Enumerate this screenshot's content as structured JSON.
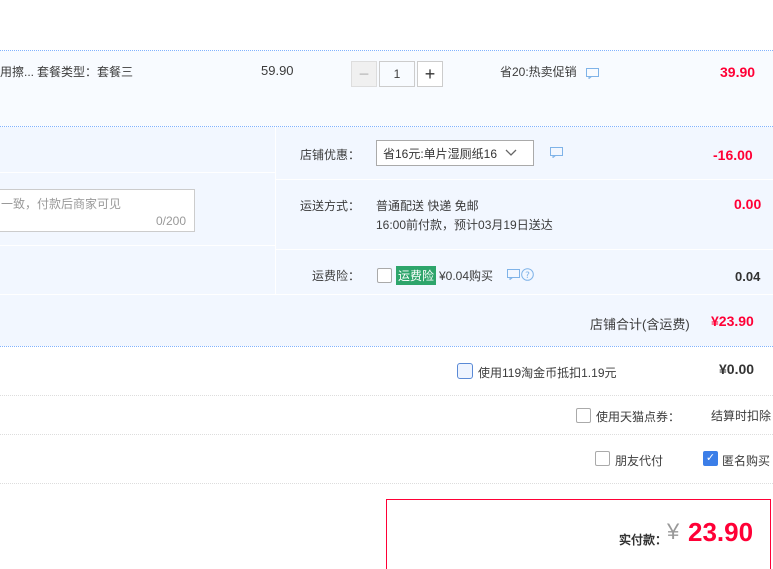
{
  "item": {
    "name_fragment": "用擦...",
    "spec": "套餐类型：套餐三",
    "unit_price": "59.90",
    "quantity": "1",
    "promo": "省20:热卖促销",
    "subtotal": "39.90",
    "minus_label": "−",
    "plus_label": "+"
  },
  "shop": {
    "discount_label": "店铺优惠：",
    "discount_selected": "省16元:单片湿厕纸16",
    "discount_value": "-16.00",
    "message_placeholder": "一致，付款后商家可见",
    "message_counter": "0/200",
    "shipping_label": "运送方式：",
    "shipping_method": "普通配送 快递 免邮",
    "shipping_note": "16:00前付款，预计03月19日送达",
    "shipping_value": "0.00",
    "insurance_label": "运费险：",
    "insurance_tag": "运费险",
    "insurance_price": "¥0.04购买",
    "insurance_value": "0.04",
    "shop_total_label": "店铺合计(含运费)",
    "shop_total_value": "¥23.90"
  },
  "options": {
    "coins_label": "使用119淘金币抵扣1.19元",
    "coins_value": "¥0.00",
    "coupon_label": "使用天猫点券：",
    "coupon_value": "结算时扣除",
    "friend_pay_label": "朋友代付",
    "anonymous_label": "匿名购买"
  },
  "checkout": {
    "actual_label": "实付款：",
    "currency": "¥",
    "amount": "23.90"
  },
  "colors": {
    "accent_red": "#ff0036",
    "accent_blue": "#3b7ee8",
    "tag_green": "#2ea56b"
  }
}
